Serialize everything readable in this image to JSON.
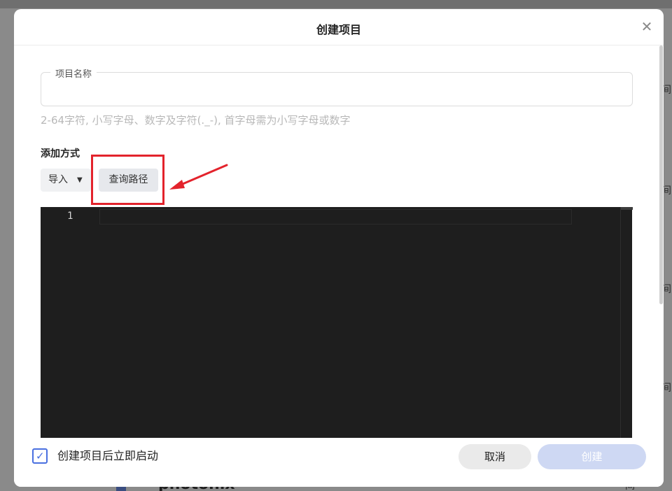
{
  "dialog": {
    "title": "创建项目",
    "close_icon": "close-icon"
  },
  "form": {
    "name_label": "项目名称",
    "name_value": "",
    "name_hint": "2-64字符, 小写字母、数字及字符(._-), 首字母需为小写字母或数字",
    "method_label": "添加方式",
    "import_label": "导入",
    "query_label": "查询路径"
  },
  "editor": {
    "line_numbers": [
      "1"
    ]
  },
  "footer": {
    "autostart_label": "创建项目后立即启动",
    "autostart_checked": true,
    "cancel_label": "取消",
    "create_label": "创建"
  },
  "background": {
    "side_text": "间",
    "bottom_title": "photonix"
  },
  "colors": {
    "accent": "#4a70e0",
    "annotation": "#e3232c",
    "editor_bg": "#1e1e1e",
    "create_disabled": "#ced8f3"
  }
}
